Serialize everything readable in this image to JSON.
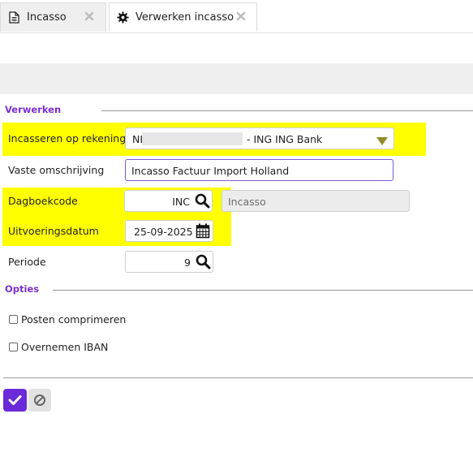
{
  "tabs": [
    {
      "label": "Incasso",
      "icon": "document-icon"
    },
    {
      "label": "Verwerken incasso",
      "icon": "gear-icon"
    }
  ],
  "sections": {
    "verwerken": "Verwerken",
    "opties": "Opties"
  },
  "fields": {
    "rekening": {
      "label": "Incasseren op rekening",
      "value_prefix": "NL",
      "value_suffix": "-  ING ING Bank"
    },
    "omschrijving": {
      "label": "Vaste omschrijving",
      "value": "Incasso Factuur Import Holland"
    },
    "dagboekcode": {
      "label": "Dagboekcode",
      "value": "INC",
      "description": "Incasso"
    },
    "uitvoeringsdatum": {
      "label": "Uitvoeringsdatum",
      "value": "25-09-2025"
    },
    "periode": {
      "label": "Periode",
      "value": "9"
    }
  },
  "options": [
    {
      "label": "Posten comprimeren",
      "checked": false
    },
    {
      "label": "Overnemen IBAN",
      "checked": false
    }
  ],
  "colors": {
    "accent": "#6b2bd9",
    "section_header": "#7b2fd1",
    "highlight": "#ffff00"
  }
}
